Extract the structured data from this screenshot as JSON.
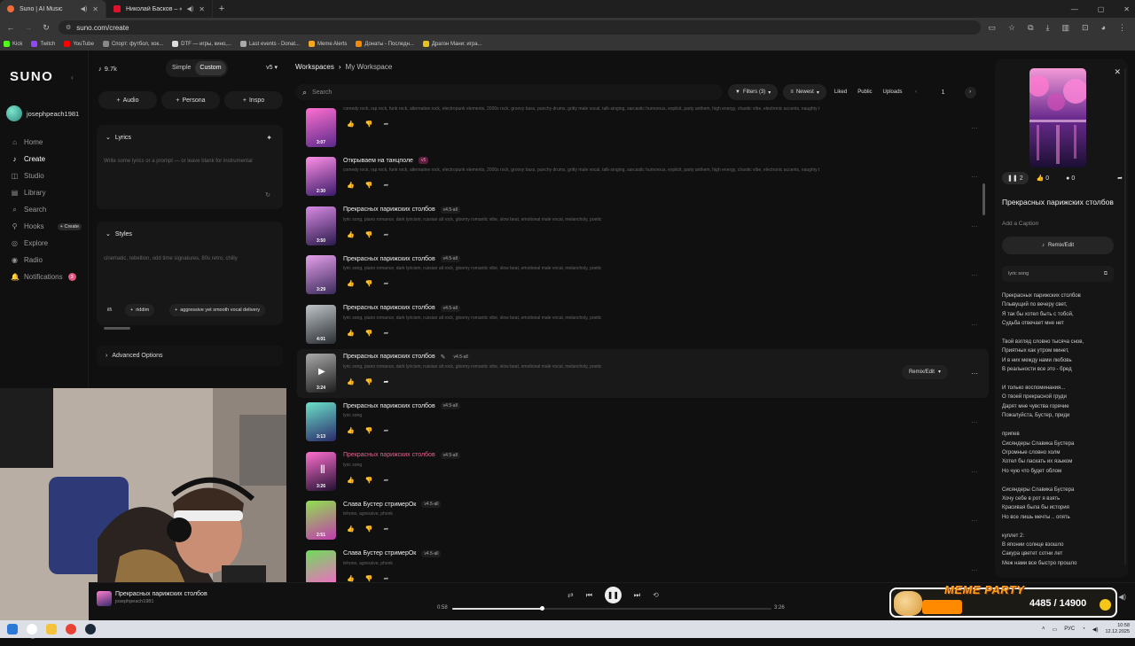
{
  "browser": {
    "tabs": [
      {
        "title": "Suno | AI Music",
        "active": true,
        "color": "#f26b3a"
      },
      {
        "title": "Николай Басков – «Обниму та",
        "active": false,
        "color": "#e0112b"
      }
    ],
    "url": "suno.com/create",
    "bookmarks": [
      {
        "label": "Kick",
        "color": "#53fc18"
      },
      {
        "label": "Twitch",
        "color": "#9146ff"
      },
      {
        "label": "YouTube",
        "color": "#ff0000"
      },
      {
        "label": "Спорт: футбол, хок...",
        "color": "#888888"
      },
      {
        "label": "DTF — игры, кино,...",
        "color": "#dddddd"
      },
      {
        "label": "Last events - Donat...",
        "color": "#aaaaaa"
      },
      {
        "label": "Meme Alerts",
        "color": "#f5a623"
      },
      {
        "label": "Донаты - Последн...",
        "color": "#f58a07"
      },
      {
        "label": "Драгон Мани: игра...",
        "color": "#e8c21a"
      }
    ]
  },
  "sidebar": {
    "logo": "SUNO",
    "username": "josephpeach1981",
    "items": [
      {
        "label": "Home",
        "icon": "⌂",
        "active": false
      },
      {
        "label": "Create",
        "icon": "♪",
        "active": true
      },
      {
        "label": "Studio",
        "icon": "◫",
        "active": false
      },
      {
        "label": "Library",
        "icon": "▤",
        "active": false
      },
      {
        "label": "Search",
        "icon": "⌕",
        "active": false
      },
      {
        "label": "Hooks",
        "icon": "⚲",
        "active": false,
        "pill": "+ Create"
      },
      {
        "label": "Explore",
        "icon": "◎",
        "active": false
      },
      {
        "label": "Radio",
        "icon": "◉",
        "active": false
      },
      {
        "label": "Notifications",
        "icon": "🔔",
        "active": false,
        "badge": "3"
      }
    ]
  },
  "create": {
    "credits": "9.7k",
    "mode_simple": "Simple",
    "mode_custom": "Custom",
    "model": "v5",
    "add_audio": "Audio",
    "add_persona": "Persona",
    "add_inspo": "Inspo",
    "lyrics_label": "Lyrics",
    "lyrics_placeholder": "Write some lyrics or a prompt — or leave blank for instrumental",
    "styles_label": "Styles",
    "styles_value": "cinematic, rebellion, odd time signatures, 80s retro, chilly",
    "style_chip_0": "ill\\",
    "style_chip_1": "riddim",
    "style_chip_2": "aggressive yet smooth vocal delivery",
    "advanced": "Advanced Options"
  },
  "main": {
    "breadcrumb_root": "Workspaces",
    "breadcrumb_current": "My Workspace",
    "search_placeholder": "Search",
    "filters": "Filters (3)",
    "sort": "Newest",
    "liked": "Liked",
    "public": "Public",
    "uploads": "Uploads",
    "page": "1",
    "remix_label": "Remix/Edit"
  },
  "songs": [
    {
      "title": "",
      "version": "",
      "tags": "comedy rock, rap rock, funk rock, alternative rock, electropunk elements, 2000s rock, groovy bass, punchy drums, gritty male vocal, talk-singing, sarcastic humorous, explicit, party anthem, high energy, chaotic vibe, electronic accents, naughty t",
      "duration": "3:07"
    },
    {
      "title": "Открываем на танцполе",
      "version": "v5",
      "tags": "comedy rock, rap rock, funk rock, alternative rock, electropunk elements, 2000s rock, groovy bass, punchy drums, gritty male vocal, talk-singing, sarcastic humorous, explicit, party anthem, high energy, chaotic vibe, electronic accents, naughty t",
      "duration": "2:30"
    },
    {
      "title": "Прекрасных парижских столбов",
      "version": "v4.5-all",
      "tags": "lyric song, piano romance, dark lyricism, russian alt rock, gloomy romantic vibe, slow beat, emotional male vocal, melancholy, poetic",
      "duration": "3:50"
    },
    {
      "title": "Прекрасных парижских столбов",
      "version": "v4.5-all",
      "tags": "lyric song, piano romance, dark lyricism, russian alt rock, gloomy romantic vibe, slow beat, emotional male vocal, melancholy, poetic",
      "duration": "3:29"
    },
    {
      "title": "Прекрасных парижских столбов",
      "version": "v4.5-all",
      "tags": "lyric song, piano romance, dark lyricism, russian alt rock, gloomy romantic vibe, slow beat, emotional male vocal, melancholy, poetic",
      "duration": "4:01"
    },
    {
      "title": "Прекрасных парижских столбов",
      "version": "v4.5-all",
      "tags": "lyric song, piano romance, dark lyricism, russian alt rock, gloomy romantic vibe, slow beat, emotional male vocal, melancholy, poetic",
      "duration": "3:24"
    },
    {
      "title": "Прекрасных парижских столбов",
      "version": "v4.5-all",
      "tags": "lyric song",
      "duration": "3:13"
    },
    {
      "title": "Прекрасных парижских столбов",
      "version": "v4.5-all",
      "tags": "lyric song",
      "duration": "3:26"
    },
    {
      "title": "Слава Бустер стримерОк",
      "version": "v4.5-all",
      "tags": "tehono, agressive, phonk",
      "duration": "2:51"
    },
    {
      "title": "Слава Бустер стримерОк",
      "version": "v4.5-all",
      "tags": "tehono, agressive, phonk",
      "duration": "1:40"
    }
  ],
  "detail": {
    "plays": "2",
    "likes": "0",
    "comments": "0",
    "title": "Прекрасных парижских столбов",
    "caption": "Add a Caption",
    "remix": "Remix/Edit",
    "style": "lyric song",
    "lyrics": "Прекрасных парижских столбов\nПлывущий по вечеру свет,\nЯ так бы хотел быть с тобой,\nСудьба отвечает мне нет\n\nТвой взгляд словно тысяча снов,\nПриятных как утром минет,\nИ в них между нами любовь\nВ реальности все это - бред\n\nИ только воспоминания...\nО твоей прекрасной груди\nДарят мне чувства горячие\nПожалуйста, Бустер, приди\n\nприпев\nСисяндеры Славика Бустера\nОгромные словно холм\nХотел бы ласкать их языком\nНо чую что будет облом\n\nСисяндеры Славика Бустера\nХочу себе в рот я взять\nКрасивая была бы история\nНо все лишь мечты .. опять\n\nкуплет 2:\nВ японии солнце взошло\nСакура цветет сотни лет\nМеж нами все быстро прошло"
  },
  "player": {
    "title": "Прекрасных парижских столбов",
    "user": "josephpeach1981",
    "elapsed": "0:58",
    "total": "3:26",
    "progress": 0.28
  },
  "overlay": {
    "label": "MEME PARTY",
    "score": "4485 / 14900"
  },
  "taskbar": {
    "lang": "РУС",
    "time": "10:58",
    "date": "12.12.2025"
  }
}
